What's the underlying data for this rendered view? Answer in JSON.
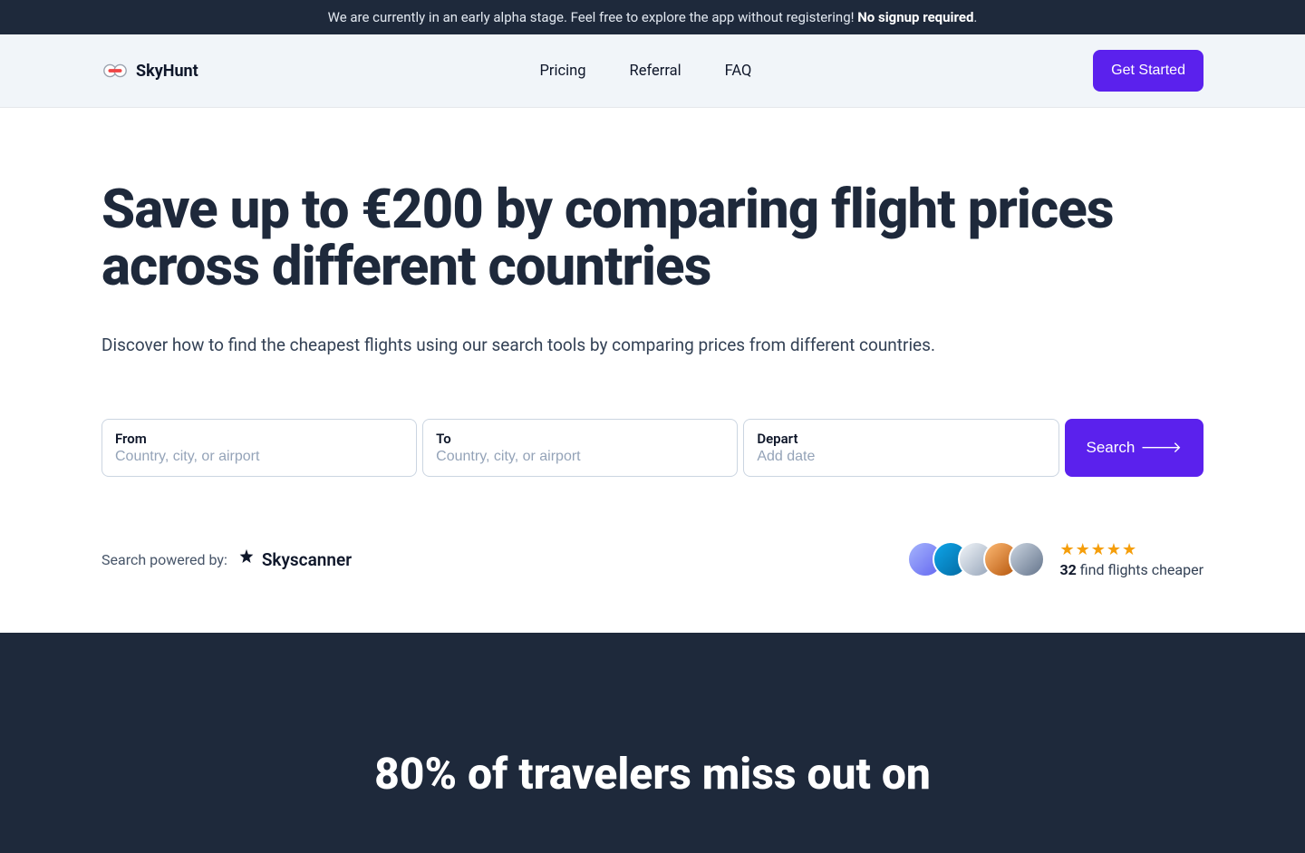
{
  "banner": {
    "text": "We are currently in an early alpha stage. Feel free to explore the app without registering! ",
    "bold": "No signup required",
    "tail": "."
  },
  "header": {
    "brand": "SkyHunt",
    "nav": {
      "pricing": "Pricing",
      "referral": "Referral",
      "faq": "FAQ"
    },
    "cta": "Get Started"
  },
  "hero": {
    "title": "Save up to €200 by comparing flight prices across different countries",
    "subtitle": "Discover how to find the cheapest flights using our search tools by comparing prices from different countries."
  },
  "search": {
    "from_label": "From",
    "from_placeholder": "Country, city, or airport",
    "to_label": "To",
    "to_placeholder": "Country, city, or airport",
    "depart_label": "Depart",
    "depart_placeholder": "Add date",
    "button": "Search"
  },
  "proof": {
    "powered_label": "Search powered by:",
    "provider": "Skyscanner",
    "count": "32",
    "count_suffix": " find flights cheaper"
  },
  "dark": {
    "heading_line1": "80% of travelers miss out on"
  }
}
